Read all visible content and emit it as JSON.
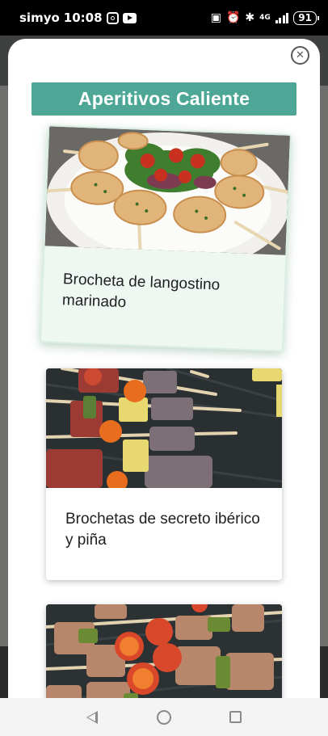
{
  "status_bar": {
    "carrier": "simyo",
    "time": "10:08",
    "network": "4G",
    "battery": "91"
  },
  "modal": {
    "section_title": "Aperitivos Caliente",
    "close_icon": "close-icon"
  },
  "cards": [
    {
      "title": "Brocheta de langostino marinado",
      "image": "shrimp-skewers-photo"
    },
    {
      "title": "Brochetas de secreto ibérico y piña",
      "image": "pork-pineapple-skewers-photo"
    },
    {
      "title": "",
      "image": "chicken-tomato-skewers-photo"
    }
  ],
  "navigation": {
    "back_icon": "back-icon",
    "home_icon": "home-icon",
    "recents_icon": "recents-icon"
  },
  "colors": {
    "accent": "#4ea796",
    "highlight_card_bg": "#eef7f1",
    "modal_bg": "#ffffff"
  }
}
